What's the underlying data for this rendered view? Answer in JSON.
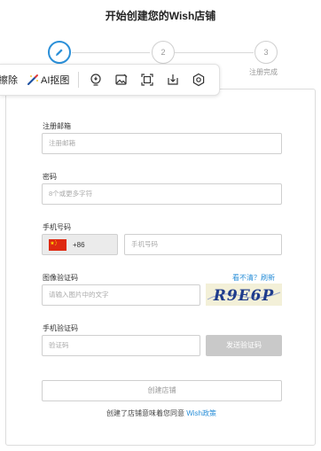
{
  "page": {
    "title": "开始创建您的Wish店铺"
  },
  "stepper": {
    "steps": [
      {
        "number": "1",
        "state": "active"
      },
      {
        "number": "2",
        "state": "pending"
      },
      {
        "number": "3",
        "state": "pending",
        "label": "注册完成"
      }
    ]
  },
  "toolbar": {
    "erase_label": "擦除",
    "ai_cutout_label": "AI抠图",
    "icons": [
      "pin-icon",
      "image-edit-icon",
      "crop-frame-icon",
      "download-icon",
      "settings-icon"
    ]
  },
  "form": {
    "email": {
      "label": "注册邮箱",
      "placeholder": "注册邮箱"
    },
    "password": {
      "label": "密码",
      "placeholder": "8个或更多字符"
    },
    "phone": {
      "label": "手机号码",
      "country_code": "+86",
      "placeholder": "手机号码",
      "flag": "china-flag"
    },
    "image_captcha": {
      "label": "图像验证码",
      "placeholder": "请输入图片中的文字",
      "refresh_link": "看不清？刷新",
      "captcha_text": "R9E6P"
    },
    "sms_code": {
      "label": "手机验证码",
      "placeholder": "验证码",
      "send_button": "发送验证码"
    },
    "create_button": "创建店铺",
    "agreement": {
      "prefix": "创建了店铺意味着您同意 ",
      "link": "Wish政策"
    }
  },
  "colors": {
    "accent": "#2a8fd8",
    "disabled_button": "#c9c9c9",
    "border": "#cfcfcf"
  }
}
